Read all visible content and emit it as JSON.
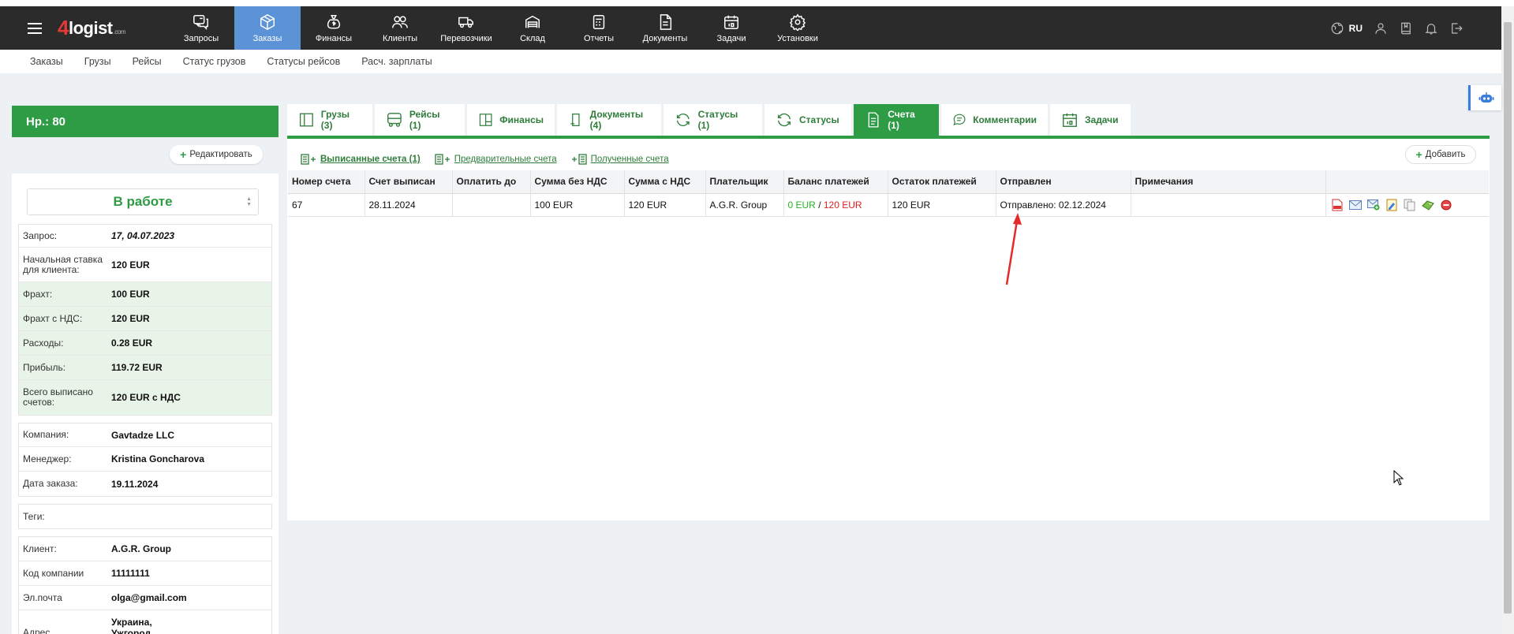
{
  "navbar": {
    "items": [
      {
        "label": "Запросы",
        "icon": "requests-icon"
      },
      {
        "label": "Заказы",
        "icon": "orders-icon",
        "active": true
      },
      {
        "label": "Финансы",
        "icon": "finance-icon"
      },
      {
        "label": "Клиенты",
        "icon": "clients-icon"
      },
      {
        "label": "Перевозчики",
        "icon": "truck-icon"
      },
      {
        "label": "Склад",
        "icon": "warehouse-icon"
      },
      {
        "label": "Отчеты",
        "icon": "reports-icon"
      },
      {
        "label": "Документы",
        "icon": "documents-icon"
      },
      {
        "label": "Задачи",
        "icon": "calendar-icon"
      },
      {
        "label": "Установки",
        "icon": "gear-icon"
      }
    ],
    "lang": "RU"
  },
  "subnav": [
    "Заказы",
    "Грузы",
    "Рейсы",
    "Статус грузов",
    "Статусы рейсов",
    "Расч. зарплаты"
  ],
  "order": {
    "title": "Нр.: 80",
    "edit_label": "Редактировать",
    "status": "В работе",
    "rows1": [
      {
        "label": "Запрос:",
        "value": "17, 04.07.2023"
      },
      {
        "label": "Начальная ставка для клиента:",
        "value": "120 EUR"
      }
    ],
    "rows_green": [
      {
        "label": "Фрахт:",
        "value": "100 EUR"
      },
      {
        "label": "Фрахт с НДС:",
        "value": "120 EUR"
      },
      {
        "label": "Расходы:",
        "value": "0.28 EUR"
      },
      {
        "label": "Прибыль:",
        "value": "119.72 EUR"
      },
      {
        "label": "Всего выписано счетов:",
        "value": "120 EUR с НДС"
      }
    ],
    "rows2": [
      {
        "label": "Компания:",
        "value": "Gavtadze LLC"
      },
      {
        "label": "Менеджер:",
        "value": "Kristina Goncharova"
      },
      {
        "label": "Дата заказа:",
        "value": "19.11.2024"
      }
    ],
    "tags_label": "Теги:",
    "rows3": [
      {
        "label": "Клиент:",
        "value": "A.G.R. Group"
      },
      {
        "label": "Код компании",
        "value": "11111111"
      },
      {
        "label": "Эл.почта",
        "value": "olga@gmail.com"
      },
      {
        "label": "Адрес",
        "value": "Украина, Ужгород"
      }
    ]
  },
  "tabs": [
    {
      "label": "Грузы (3)",
      "icon": "cargo-icon"
    },
    {
      "label": "Рейсы (1)",
      "icon": "bus-icon"
    },
    {
      "label": "Финансы",
      "icon": "finance-tab-icon"
    },
    {
      "label": "Документы (4)",
      "icon": "document-tab-icon"
    },
    {
      "label": "Статусы (1)",
      "icon": "refresh-icon"
    },
    {
      "label": "Статусы",
      "icon": "refresh-icon"
    },
    {
      "label": "Счета (1)",
      "icon": "invoice-icon",
      "active": true
    },
    {
      "label": "Комментарии",
      "icon": "comment-icon"
    },
    {
      "label": "Задачи",
      "icon": "calendar-tab-icon"
    }
  ],
  "subtabs": [
    {
      "label": "Выписанные счета (1)",
      "active": true
    },
    {
      "label": "Предварительные счета"
    },
    {
      "label": "Полученные счета"
    }
  ],
  "add_label": "Добавить",
  "table": {
    "headers": [
      "Номер счета",
      "Счет выписан",
      "Оплатить до",
      "Сумма без НДС",
      "Сумма с НДС",
      "Плательщик",
      "Баланс платежей",
      "Остаток платежей",
      "Отправлен",
      "Примечания",
      ""
    ],
    "row": {
      "number": "67",
      "issued": "28.11.2024",
      "due": "",
      "net": "100 EUR",
      "gross": "120 EUR",
      "payer": "A.G.R. Group",
      "balance_paid": "0 EUR",
      "balance_sep": "/",
      "balance_total": "120 EUR",
      "remaining": "120 EUR",
      "sent": "Отправлено: 02.12.2024",
      "notes": ""
    },
    "actions": [
      "pdf-icon",
      "email-icon",
      "email-add-icon",
      "edit-icon",
      "copy-icon",
      "pay-icon",
      "delete-icon"
    ]
  },
  "colors": {
    "green": "#2e9b45",
    "nav": "#2b2b2b",
    "active_nav": "#5b93d6",
    "red": "#e02020"
  }
}
